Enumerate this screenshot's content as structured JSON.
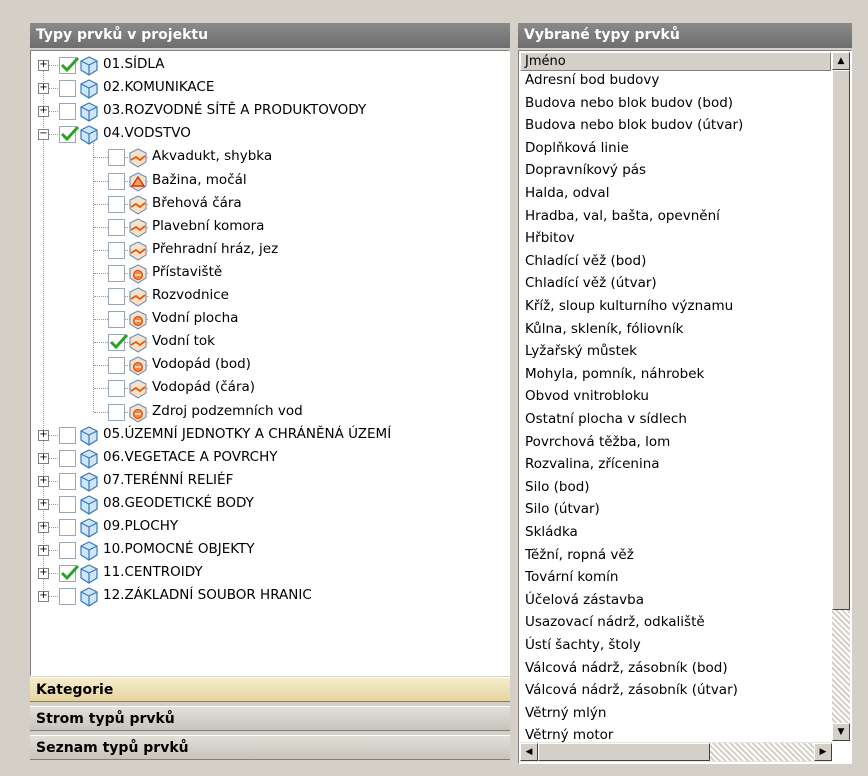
{
  "left_panel": {
    "title": "Typy prvků v projektu",
    "tree": [
      {
        "level": 0,
        "label": "01.SÍDLA",
        "checked": true,
        "expander": "+",
        "icon": "cube-icon"
      },
      {
        "level": 0,
        "label": "02.KOMUNIKACE",
        "checked": false,
        "expander": "+",
        "icon": "cube-icon"
      },
      {
        "level": 0,
        "label": "03.ROZVODNÉ SÍTĚ A PRODUKTOVODY",
        "checked": false,
        "expander": "+",
        "icon": "cube-icon"
      },
      {
        "level": 0,
        "label": "04.VODSTVO",
        "checked": true,
        "expander": "−",
        "icon": "cube-icon"
      },
      {
        "level": 1,
        "label": "Akvadukt, shybka",
        "checked": false,
        "icon": "line-feature-icon"
      },
      {
        "level": 1,
        "label": "Bažina, močál",
        "checked": false,
        "icon": "area-feature-icon"
      },
      {
        "level": 1,
        "label": "Břehová čára",
        "checked": false,
        "icon": "line-feature-icon"
      },
      {
        "level": 1,
        "label": "Plavební komora",
        "checked": false,
        "icon": "line-feature-icon"
      },
      {
        "level": 1,
        "label": "Přehradní hráz, jez",
        "checked": false,
        "icon": "line-feature-icon"
      },
      {
        "level": 1,
        "label": "Přístaviště",
        "checked": false,
        "icon": "point-feature-icon"
      },
      {
        "level": 1,
        "label": "Rozvodnice",
        "checked": false,
        "icon": "line-feature-icon"
      },
      {
        "level": 1,
        "label": "Vodní plocha",
        "checked": false,
        "icon": "point-feature-icon"
      },
      {
        "level": 1,
        "label": "Vodní tok",
        "checked": true,
        "icon": "line-feature-icon"
      },
      {
        "level": 1,
        "label": "Vodopád (bod)",
        "checked": false,
        "icon": "point-feature-icon"
      },
      {
        "level": 1,
        "label": "Vodopád (čára)",
        "checked": false,
        "icon": "line-feature-icon"
      },
      {
        "level": 1,
        "label": "Zdroj podzemních vod",
        "checked": false,
        "icon": "point-feature-icon"
      },
      {
        "level": 0,
        "label": "05.ÚZEMNÍ JEDNOTKY A CHRÁNĚNÁ ÚZEMÍ",
        "checked": false,
        "expander": "+",
        "icon": "cube-icon"
      },
      {
        "level": 0,
        "label": "06.VEGETACE A POVRCHY",
        "checked": false,
        "expander": "+",
        "icon": "cube-icon"
      },
      {
        "level": 0,
        "label": "07.TERÉNNÍ RELIÉF",
        "checked": false,
        "expander": "+",
        "icon": "cube-icon"
      },
      {
        "level": 0,
        "label": "08.GEODETICKÉ BODY",
        "checked": false,
        "expander": "+",
        "icon": "cube-icon"
      },
      {
        "level": 0,
        "label": "09.PLOCHY",
        "checked": false,
        "expander": "+",
        "icon": "cube-icon"
      },
      {
        "level": 0,
        "label": "10.POMOCNÉ OBJEKTY",
        "checked": false,
        "expander": "+",
        "icon": "cube-icon"
      },
      {
        "level": 0,
        "label": "11.CENTROIDY",
        "checked": true,
        "expander": "+",
        "icon": "cube-icon"
      },
      {
        "level": 0,
        "label": "12.ZÁKLADNÍ SOUBOR HRANIC",
        "checked": false,
        "expander": "+",
        "icon": "cube-icon"
      }
    ],
    "bars": [
      {
        "label": "Kategorie",
        "active": true
      },
      {
        "label": "Strom typů prvků",
        "active": false
      },
      {
        "label": "Seznam typů prvků",
        "active": false
      }
    ]
  },
  "right_panel": {
    "title": "Vybrané typy prvků",
    "column_header": "Jméno",
    "items": [
      "Adresní bod budovy",
      "Budova nebo blok budov (bod)",
      "Budova nebo blok budov (útvar)",
      "Doplňková linie",
      "Dopravníkový pás",
      "Halda, odval",
      "Hradba, val, bašta, opevnění",
      "Hřbitov",
      "Chladící věž (bod)",
      "Chladící věž (útvar)",
      "Kříž, sloup kulturního významu",
      "Kůlna, skleník, fóliovník",
      "Lyžařský můstek",
      "Mohyla, pomník, náhrobek",
      "Obvod vnitrobloku",
      "Ostatní plocha v sídlech",
      "Povrchová těžba, lom",
      "Rozvalina, zřícenina",
      "Silo (bod)",
      "Silo (útvar)",
      "Skládka",
      "Těžní, ropná věž",
      "Tovární komín",
      "Účelová zástavba",
      "Usazovací nádrž, odkaliště",
      "Ústí šachty, štoly",
      "Válcová nádrž, zásobník (bod)",
      "Válcová nádrž, zásobník (útvar)",
      "Větrný mlýn",
      "Větrný motor"
    ]
  },
  "colors": {
    "header_bg": "#7b7b7b",
    "active_bar": "#f0e4b8",
    "inactive_bar": "#d4d0c8",
    "check_green": "#2aa22a"
  }
}
